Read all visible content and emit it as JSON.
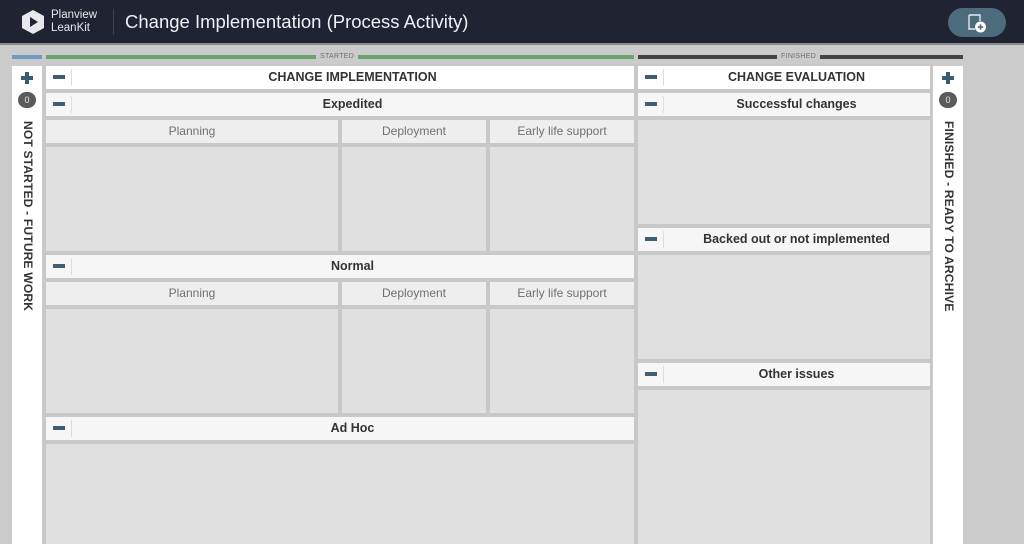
{
  "header": {
    "brand_line1": "Planview",
    "brand_line2": "LeanKit",
    "title": "Change Implementation (Process Activity)",
    "add_card_icon": "add-card-icon"
  },
  "phases": {
    "backlog_color": "#6f9bc6",
    "started_label": "STARTED",
    "started_color": "#6aa56d",
    "finished_label": "FINISHED",
    "finished_color": "#444444"
  },
  "left_lane": {
    "label": "NOT STARTED - FUTURE WORK",
    "count": "0",
    "add_icon": "plus-icon"
  },
  "right_lane": {
    "label": "FINISHED - READY TO ARCHIVE",
    "count": "0",
    "add_icon": "plus-icon"
  },
  "change_implementation": {
    "title": "CHANGE IMPLEMENTATION",
    "lanes": [
      {
        "title": "Expedited",
        "columns": [
          "Planning",
          "Deployment",
          "Early life support"
        ]
      },
      {
        "title": "Normal",
        "columns": [
          "Planning",
          "Deployment",
          "Early life support"
        ]
      },
      {
        "title": "Ad Hoc",
        "columns": []
      }
    ]
  },
  "change_evaluation": {
    "title": "CHANGE EVALUATION",
    "lanes": [
      {
        "title": "Successful changes"
      },
      {
        "title": "Backed out or not implemented"
      },
      {
        "title": "Other issues"
      }
    ]
  }
}
